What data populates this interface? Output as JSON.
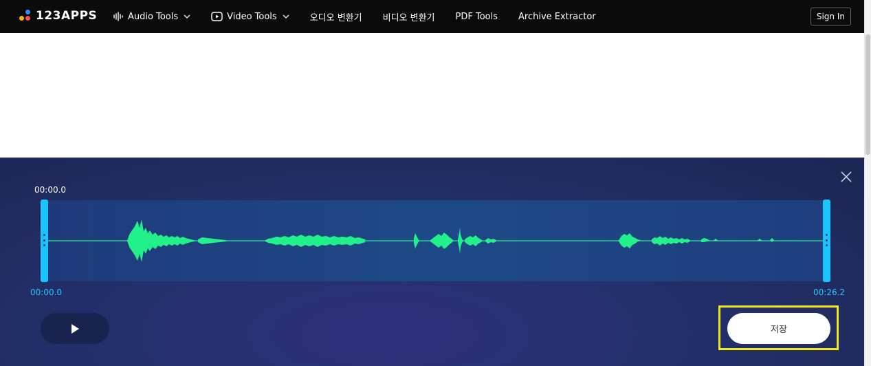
{
  "nav": {
    "logo_text": "123APPS",
    "items": [
      {
        "label": "Audio Tools",
        "icon": "waveform-icon",
        "dropdown": true
      },
      {
        "label": "Video Tools",
        "icon": "play-square-icon",
        "dropdown": true
      },
      {
        "label": "오디오 변환기"
      },
      {
        "label": "비디오 변환기"
      },
      {
        "label": "PDF Tools"
      },
      {
        "label": "Archive Extractor"
      }
    ],
    "signin_label": "Sign In"
  },
  "editor": {
    "time_top": "00:00.0",
    "start_time": "00:00.0",
    "end_time": "00:26.2",
    "save_label": "저장",
    "colors": {
      "waveform": "#22f08a",
      "handle": "#19c4ff",
      "highlight": "#f2ea1f"
    }
  }
}
